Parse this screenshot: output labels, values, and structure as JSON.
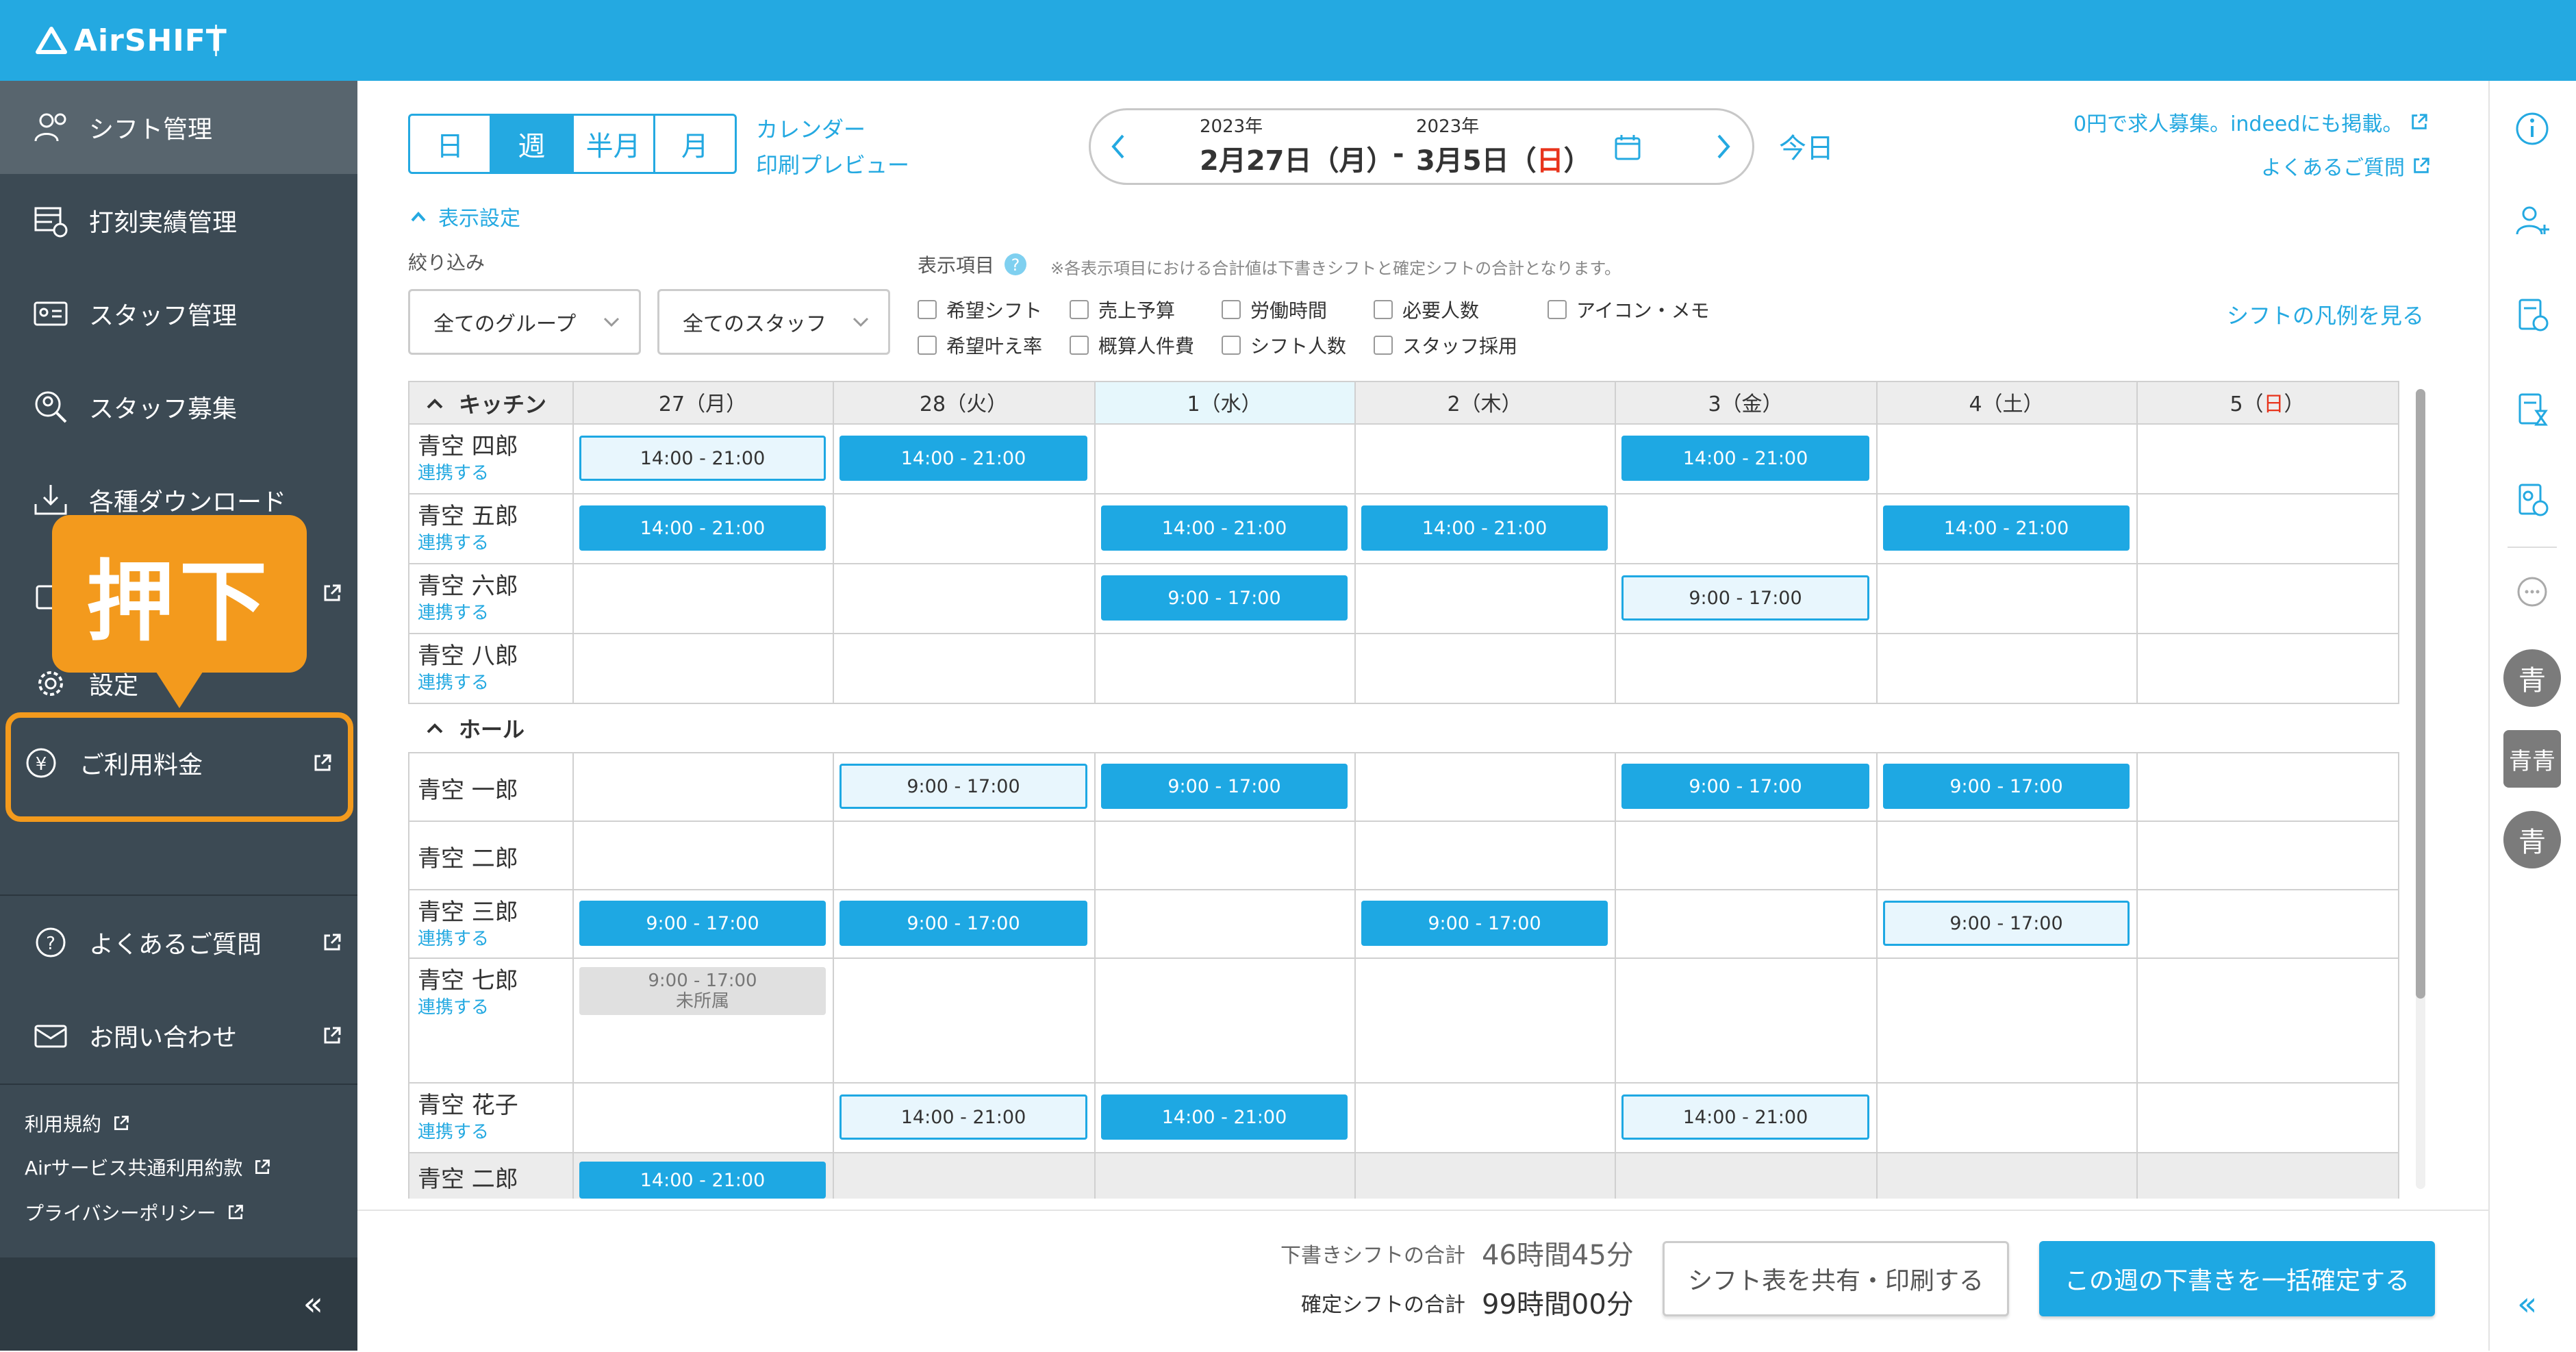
{
  "app": {
    "logo": "AirSHIFT"
  },
  "colors": {
    "brand": "#24a9e1",
    "sidebar": "#3c4a54",
    "callout": "#f39a1d",
    "sunday": "#e8341c"
  },
  "sidebar": {
    "items": [
      {
        "label": "シフト管理",
        "icon": "people-gear-icon"
      },
      {
        "label": "打刻実績管理",
        "icon": "timesheet-icon"
      },
      {
        "label": "スタッフ管理",
        "icon": "id-card-icon"
      },
      {
        "label": "スタッフ募集",
        "icon": "person-search-icon"
      },
      {
        "label": "各種ダウンロード",
        "icon": "download-icon"
      },
      {
        "label": "",
        "icon": "bag-icon"
      },
      {
        "label": "設定",
        "icon": "gear-icon"
      },
      {
        "label": "ご利用料金",
        "icon": "yen-icon"
      }
    ],
    "help": "よくあるご質問",
    "contact": "お問い合わせ",
    "links": [
      "利用規約",
      "Airサービス共通利用約款",
      "プライバシーポリシー"
    ],
    "collapse": "«"
  },
  "callout": {
    "text": "押下"
  },
  "view": {
    "segments": [
      "日",
      "週",
      "半月",
      "月"
    ],
    "calendar_print": [
      "カレンダー",
      "印刷プレビュー"
    ],
    "date_from_year": "2023年",
    "date_from": "2月27日（月）",
    "date_sep": "-",
    "date_to_year": "2023年",
    "date_to_pre": "3月5日（",
    "date_to_day": "日",
    "date_to_post": "）",
    "today": "今日",
    "recruit": "0円で求人募集。indeedにも掲載。",
    "faq": "よくあるご質問",
    "display_settings": "表示設定",
    "filter_label": "絞り込み",
    "group_select": "全てのグループ",
    "staff_select": "全てのスタッフ",
    "items_label": "表示項目",
    "items_note": "※各表示項目における合計値は下書きシフトと確定シフトの合計となります。",
    "checkboxes_row1": [
      "希望シフト",
      "売上予算",
      "労働時間",
      "必要人数",
      "アイコン・メモ"
    ],
    "checkboxes_row2": [
      "希望叶え率",
      "概算人件費",
      "シフト人数",
      "スタッフ採用"
    ],
    "legend_link": "シフトの凡例を見る"
  },
  "grid": {
    "days": [
      "27（月）",
      "28（火）",
      "1（水）",
      "2（木）",
      "3（金）",
      "4（土）",
      "5（日）"
    ],
    "groups": [
      "キッチン",
      "ホール"
    ],
    "link_text": "連携する",
    "rows": [
      {
        "name": "青空 四郎",
        "link": true,
        "shifts": [
          [
            "14:00 - 21:00",
            "out"
          ],
          [
            "14:00 - 21:00",
            "fill"
          ],
          null,
          null,
          [
            "14:00 - 21:00",
            "fill"
          ],
          null,
          null
        ]
      },
      {
        "name": "青空 五郎",
        "link": true,
        "shifts": [
          [
            "14:00 - 21:00",
            "fill"
          ],
          null,
          [
            "14:00 - 21:00",
            "fill"
          ],
          [
            "14:00 - 21:00",
            "fill"
          ],
          null,
          [
            "14:00 - 21:00",
            "fill"
          ],
          null
        ]
      },
      {
        "name": "青空 六郎",
        "link": true,
        "shifts": [
          null,
          null,
          [
            "9:00 - 17:00",
            "fill"
          ],
          null,
          [
            "9:00 - 17:00",
            "out"
          ],
          null,
          null
        ]
      },
      {
        "name": "青空 八郎",
        "link": true,
        "shifts": [
          null,
          null,
          null,
          null,
          null,
          null,
          null
        ]
      },
      {
        "name": "青空 一郎",
        "link": false,
        "shifts": [
          null,
          [
            "9:00 - 17:00",
            "out"
          ],
          [
            "9:00 - 17:00",
            "fill"
          ],
          null,
          [
            "9:00 - 17:00",
            "fill"
          ],
          [
            "9:00 - 17:00",
            "fill"
          ],
          null
        ]
      },
      {
        "name": "青空 二郎",
        "link": false,
        "shifts": [
          null,
          null,
          null,
          null,
          null,
          null,
          null
        ]
      },
      {
        "name": "青空 三郎",
        "link": true,
        "shifts": [
          [
            "9:00 - 17:00",
            "fill"
          ],
          [
            "9:00 - 17:00",
            "fill"
          ],
          null,
          [
            "9:00 - 17:00",
            "fill"
          ],
          null,
          [
            "9:00 - 17:00",
            "out"
          ],
          null
        ]
      },
      {
        "name": "青空 七郎",
        "link": true,
        "shifts": [
          [
            "9:00 - 17:00",
            "gray"
          ],
          null,
          null,
          null,
          null,
          null,
          null
        ]
      },
      {
        "name": "青空 花子",
        "link": true,
        "shifts": [
          null,
          [
            "14:00 - 21:00",
            "out"
          ],
          [
            "14:00 - 21:00",
            "fill"
          ],
          null,
          [
            "14:00 - 21:00",
            "out"
          ],
          null,
          null
        ]
      },
      {
        "name": "青空 二郎",
        "link": false,
        "shifts": [
          [
            "14:00 - 21:00",
            "fill"
          ],
          null,
          null,
          null,
          null,
          null,
          null
        ]
      }
    ],
    "unaffiliated": "未所属"
  },
  "footer": {
    "draft_label": "下書きシフトの合計",
    "draft_total": "46時間45分",
    "confirmed_label": "確定シフトの合計",
    "confirmed_total": "99時間00分",
    "share_button": "シフト表を共有・印刷する",
    "confirm_button": "この週の下書きを一括確定する"
  },
  "rightbar": {
    "avatars": [
      "青",
      "青青",
      "青"
    ]
  }
}
